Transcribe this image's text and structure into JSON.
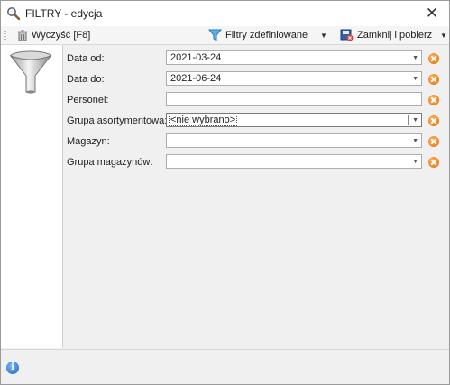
{
  "window": {
    "title": "FILTRY - edycja",
    "close_glyph": "✕"
  },
  "toolbar": {
    "clear_label": "Wyczyść [F8]",
    "filters_label": "Filtry zdefiniowane",
    "close_fetch_label": "Zamknij i pobierz",
    "arrow": "▼"
  },
  "fields": [
    {
      "label": "Data od:",
      "value": "2021-03-24",
      "type": "dropdown"
    },
    {
      "label": "Data do:",
      "value": "2021-06-24",
      "type": "dropdown"
    },
    {
      "label": "Personel:",
      "value": "",
      "type": "text"
    },
    {
      "label": "Grupa asortymentowa:",
      "value": "<nie wybrano>",
      "type": "dropdown"
    },
    {
      "label": "Magazyn:",
      "value": "",
      "type": "dropdown"
    },
    {
      "label": "Grupa magazynów:",
      "value": "",
      "type": "dropdown"
    }
  ],
  "status": {
    "info_glyph": "i"
  }
}
